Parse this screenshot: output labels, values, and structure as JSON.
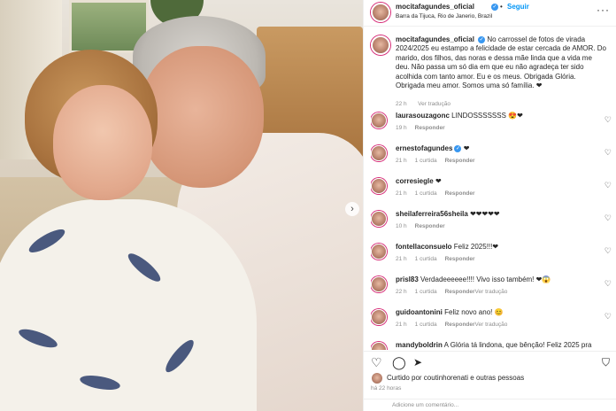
{
  "post": {
    "username": "mocitafagundes_oficial",
    "follow_label": "Seguir",
    "location": "Barra da Tijuca, Rio de Janerio, Brazil",
    "caption": "No carrossel de fotos de virada 2024/2025 eu estampo a felicidade de estar cercada de AMOR. Do marido, dos filhos, das noras e dessa mãe linda que a vida me deu. Não passa um só dia em que eu não agradeça ter sido acolhida com tanto amor. Eu e os meus. Obrigada Glória. Obrigada meu amor. Somos uma só família. ❤",
    "caption_time": "22 h",
    "see_translation": "Ver tradução"
  },
  "comments": [
    {
      "user": "laurasouzagonc",
      "text": "LINDOSSSSSSS 😍❤",
      "time": "19 h",
      "likes": "",
      "reply": "Responder",
      "translate": ""
    },
    {
      "user": "ernestofagundes",
      "text": "❤",
      "time": "21 h",
      "likes": "1 curtida",
      "reply": "Responder",
      "translate": "",
      "verified": true
    },
    {
      "user": "corresiegle",
      "text": "❤",
      "time": "21 h",
      "likes": "1 curtida",
      "reply": "Responder",
      "translate": ""
    },
    {
      "user": "sheilaferreira56sheila",
      "text": "❤❤❤❤❤",
      "time": "10 h",
      "likes": "",
      "reply": "Responder",
      "translate": ""
    },
    {
      "user": "fontellaconsuelo",
      "text": "Feliz 2025!!!❤",
      "time": "21 h",
      "likes": "1 curtida",
      "reply": "Responder",
      "translate": ""
    },
    {
      "user": "prisl83",
      "text": "Verdadeeeeee!!!! Vivo isso também! ❤😱",
      "time": "22 h",
      "likes": "1 curtida",
      "reply": "Responder",
      "translate": "Ver tradução"
    },
    {
      "user": "guidoantonini",
      "text": "Feliz novo ano! 😊",
      "time": "21 h",
      "likes": "1 curtida",
      "reply": "Responder",
      "translate": "Ver tradução"
    },
    {
      "user": "mandyboldrin",
      "text": "A Glória tá lindona, que bênção! Feliz 2025 pra",
      "time": "",
      "likes": "",
      "reply": "",
      "translate": ""
    }
  ],
  "likes": {
    "text": "Curtido por coutinhorenati e outras pessoas",
    "time": "há 22 horas"
  },
  "add_comment": {
    "placeholder": "Adicione um comentário..."
  },
  "icons": {
    "like": "heart-icon",
    "comment": "comment-icon",
    "share": "share-icon",
    "save": "bookmark-icon",
    "more": "more-icon"
  },
  "colors": {
    "follow_blue": "#0095f6",
    "verified_blue": "#3897f0",
    "heart_red": "#ed4956"
  }
}
